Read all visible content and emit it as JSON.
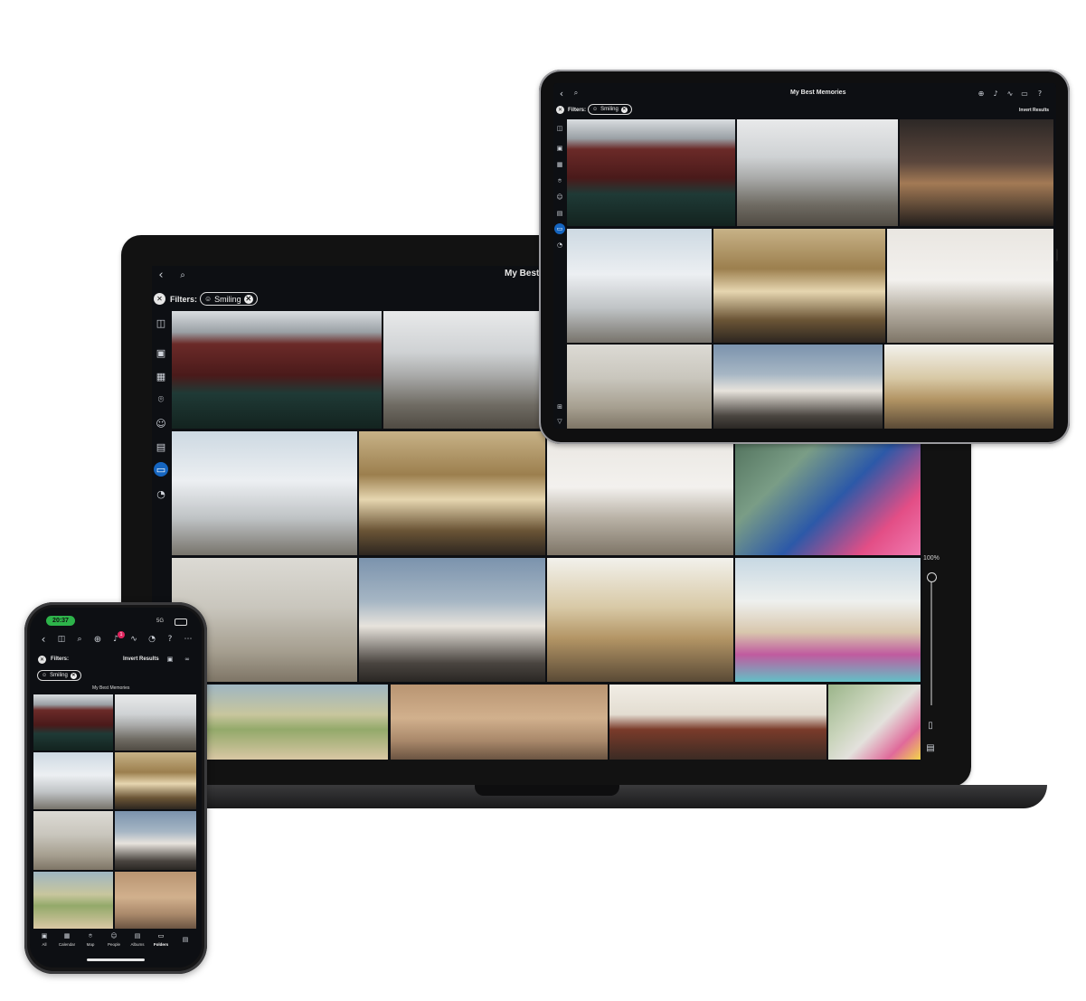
{
  "app": {
    "title": "My Best Memories",
    "filters_label": "Filters:",
    "filter_chip": "Smiling",
    "invert_results": "Invert Results",
    "zoom": "100%"
  },
  "phone": {
    "time": "20:37",
    "signal": "5G",
    "notification_count": "1",
    "nav": [
      "All",
      "Calendar",
      "Map",
      "People",
      "Albums",
      "Folders"
    ]
  },
  "icons": {
    "back": "chevron-left-icon",
    "search": "search-icon",
    "close": "close-icon",
    "add": "plus-circle-icon",
    "bell": "bell-icon",
    "activity": "pulse-icon",
    "devices": "devices-icon",
    "help": "help-icon"
  },
  "colors": {
    "background": "#0d0f13",
    "accent": "#1565c0",
    "status_green": "#2db34a",
    "badge": "#e0245e"
  }
}
